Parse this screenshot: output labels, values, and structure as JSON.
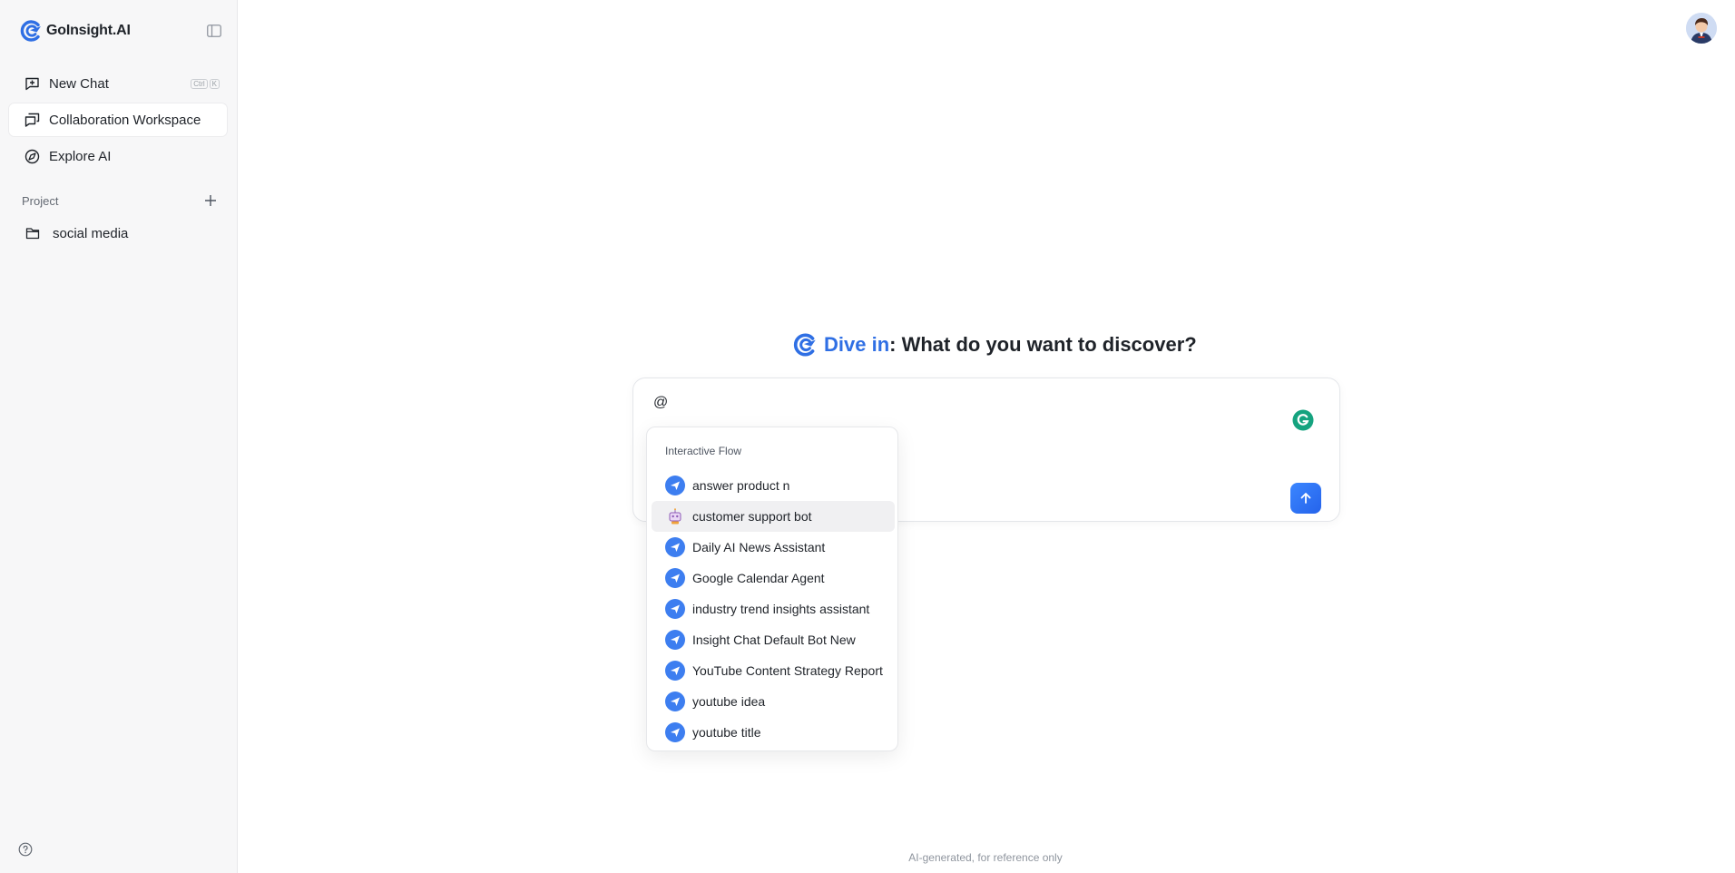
{
  "brand": {
    "name": "GoInsight.AI"
  },
  "nav": {
    "new_chat": {
      "label": "New Chat",
      "shortcut": [
        "Ctrl",
        "K"
      ]
    },
    "collab": {
      "label": "Collaboration Workspace"
    },
    "explore": {
      "label": "Explore AI"
    }
  },
  "project": {
    "section_label": "Project",
    "items": [
      {
        "label": "social media"
      }
    ]
  },
  "hero": {
    "highlight": "Dive in",
    "rest": ": What do you want to discover?"
  },
  "composer": {
    "value": "@"
  },
  "dropdown": {
    "header": "Interactive Flow",
    "items": [
      {
        "label": "answer product n",
        "icon": "send-icon"
      },
      {
        "label": "customer support bot",
        "icon": "robot-icon"
      },
      {
        "label": "Daily AI News Assistant",
        "icon": "send-icon"
      },
      {
        "label": "Google Calendar Agent",
        "icon": "send-icon"
      },
      {
        "label": "industry trend insights assistant",
        "icon": "send-icon"
      },
      {
        "label": "Insight Chat Default Bot New",
        "icon": "send-icon"
      },
      {
        "label": "YouTube Content Strategy Report",
        "icon": "send-icon"
      },
      {
        "label": "youtube idea",
        "icon": "send-icon"
      },
      {
        "label": "youtube title",
        "icon": "send-icon"
      }
    ]
  },
  "footer": {
    "text": "AI-generated, for reference only"
  },
  "colors": {
    "accent": "#2f6fe4",
    "sidebar_bg": "#f7f7f8",
    "grammarly": "#15a37f"
  }
}
